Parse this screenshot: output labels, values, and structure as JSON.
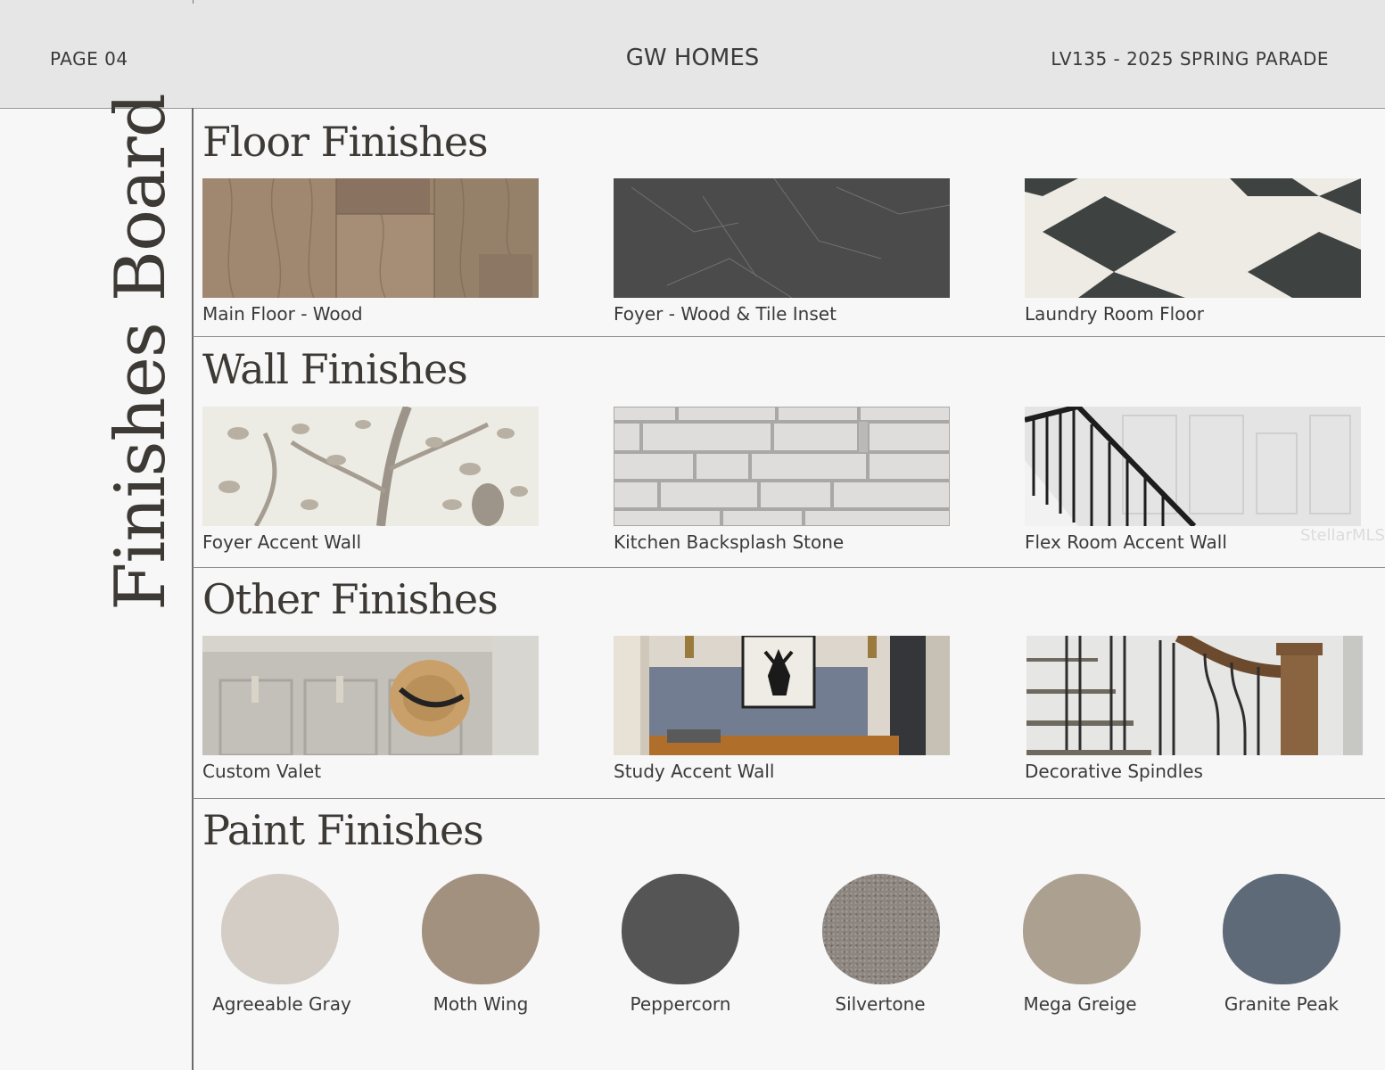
{
  "header": {
    "page": "PAGE 04",
    "brand": "GW HOMES",
    "project": "LV135 - 2025 SPRING PARADE"
  },
  "sidebar": {
    "title": "Finishes Board"
  },
  "sections": {
    "floor": {
      "title": "Floor Finishes",
      "items": [
        {
          "label": "Main Floor - Wood"
        },
        {
          "label": "Foyer - Wood & Tile Inset"
        },
        {
          "label": "Laundry Room Floor"
        }
      ]
    },
    "wall": {
      "title": "Wall Finishes",
      "items": [
        {
          "label": "Foyer Accent Wall"
        },
        {
          "label": "Kitchen Backsplash Stone"
        },
        {
          "label": "Flex Room Accent Wall"
        }
      ]
    },
    "other": {
      "title": "Other Finishes",
      "items": [
        {
          "label": "Custom Valet"
        },
        {
          "label": "Study Accent Wall"
        },
        {
          "label": "Decorative Spindles"
        }
      ]
    },
    "paint": {
      "title": "Paint Finishes",
      "items": [
        {
          "label": "Agreeable Gray",
          "color": "#d3cdc5"
        },
        {
          "label": "Moth Wing",
          "color": "#a39180"
        },
        {
          "label": "Peppercorn",
          "color": "#555556"
        },
        {
          "label": "Silvertone",
          "color": "#8c8580"
        },
        {
          "label": "Mega Greige",
          "color": "#aca091"
        },
        {
          "label": "Granite Peak",
          "color": "#5f6a78"
        }
      ]
    }
  },
  "watermark": "StellarMLS"
}
